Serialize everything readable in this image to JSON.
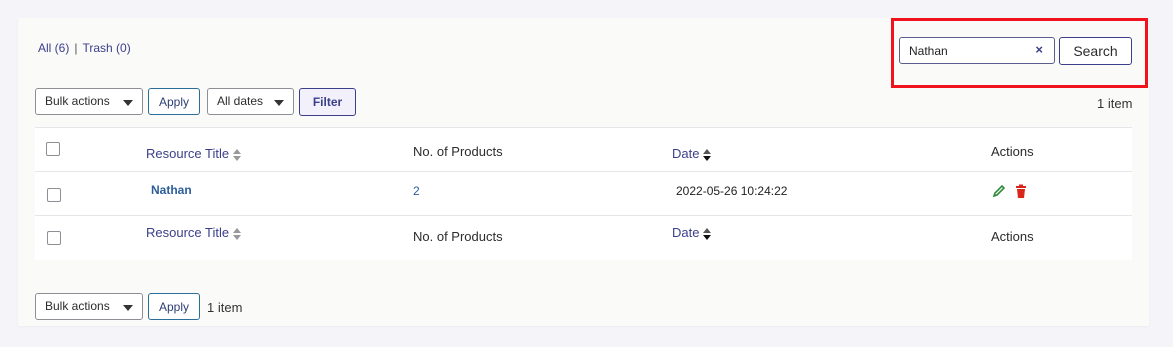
{
  "views": {
    "all_label": "All (6)",
    "separator": "|",
    "trash_label": "Trash (0)"
  },
  "search": {
    "value": "Nathan",
    "clear_glyph": "×",
    "button_label": "Search"
  },
  "top_actions": {
    "bulk_actions": "Bulk actions",
    "apply": "Apply",
    "dates": "All dates",
    "filter": "Filter",
    "item_count": "1 item"
  },
  "table": {
    "columns": {
      "resource_title": "Resource Title",
      "products": "No. of Products",
      "date": "Date",
      "actions": "Actions"
    },
    "rows": [
      {
        "title": "Nathan",
        "products": "2",
        "date": "2022-05-26 10:24:22",
        "actions": [
          "edit-icon",
          "trash-icon"
        ]
      }
    ]
  },
  "bottom_actions": {
    "bulk_actions": "Bulk actions",
    "apply": "Apply",
    "item_count": "1 item"
  },
  "colors": {
    "accent": "#3b3f8a",
    "highlight": "#f0131e",
    "edit": "#2e8b3a",
    "delete": "#d9261c"
  }
}
